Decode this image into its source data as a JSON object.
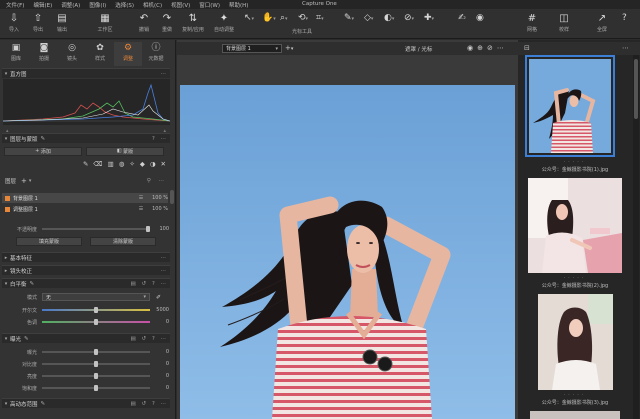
{
  "menu": [
    "文件(F)",
    "编辑(E)",
    "调整(A)",
    "图像(I)",
    "选择(S)",
    "相机(C)",
    "视图(V)",
    "窗口(W)",
    "帮助(H)"
  ],
  "app_title": "Capture One",
  "toolbar": {
    "import": "导入",
    "export": "导出",
    "output": "输出",
    "workspace": "工作区",
    "undo": "撤销",
    "redo": "重做",
    "copy_apply": "复制/应用",
    "auto_adjust": "自动调整",
    "cursor_tools": "光标工具",
    "grid": "网格",
    "proof": "校样",
    "fullscreen": "全屏"
  },
  "tool_tabs": [
    "图库",
    "拍摄",
    "镜头",
    "样式",
    "调整",
    "元数据"
  ],
  "left": {
    "histogram": "直方图",
    "layers_masks": "图层与蒙版",
    "add_layer": "添加",
    "mask": "蒙版",
    "layers_label": "图层",
    "layers": [
      {
        "name": "背景图层 1",
        "opacity": "100 %"
      },
      {
        "name": "调整图层 1",
        "opacity": "100 %"
      }
    ],
    "opacity_label": "不透明度",
    "opacity_value": "100",
    "fill_mask": "填充蒙版",
    "clear_mask": "清除蒙版",
    "basic": "基本特征",
    "lens": "镜头校正",
    "white_balance": {
      "title": "白平衡",
      "mode_label": "模式",
      "mode_value": "无",
      "kelvin_label": "开尔文",
      "kelvin_value": "5000",
      "tint_label": "色调",
      "tint_value": "0"
    },
    "exposure": {
      "title": "曝光",
      "rows": [
        {
          "label": "曝光",
          "value": "0"
        },
        {
          "label": "对比度",
          "value": "0"
        },
        {
          "label": "亮度",
          "value": "0"
        },
        {
          "label": "饱和度",
          "value": "0"
        }
      ]
    },
    "hdr": "高动态范围"
  },
  "viewer": {
    "variant_select": "背景图层 1",
    "cursor_mode": "遮罩 / 光标"
  },
  "filmstrip": {
    "captions": [
      "公众号：金鲸摄影书院(1).jpg",
      "公众号：金鲸摄影书院(2).jpg",
      "公众号：金鲸摄影书院(3).jpg"
    ]
  },
  "colors": {
    "accent": "#e8873a",
    "selection": "#3c7fd6",
    "sky": "#7aaee0",
    "panel": "#333333"
  },
  "icons": [
    "import-icon",
    "export-icon",
    "output-icon",
    "workspace-icon",
    "undo-icon",
    "redo-icon",
    "copy-apply-icon",
    "auto-adjust-icon",
    "cursor-icon",
    "pan-icon",
    "grid-icon",
    "fullscreen-icon",
    "eye-icon",
    "more-icon"
  ]
}
